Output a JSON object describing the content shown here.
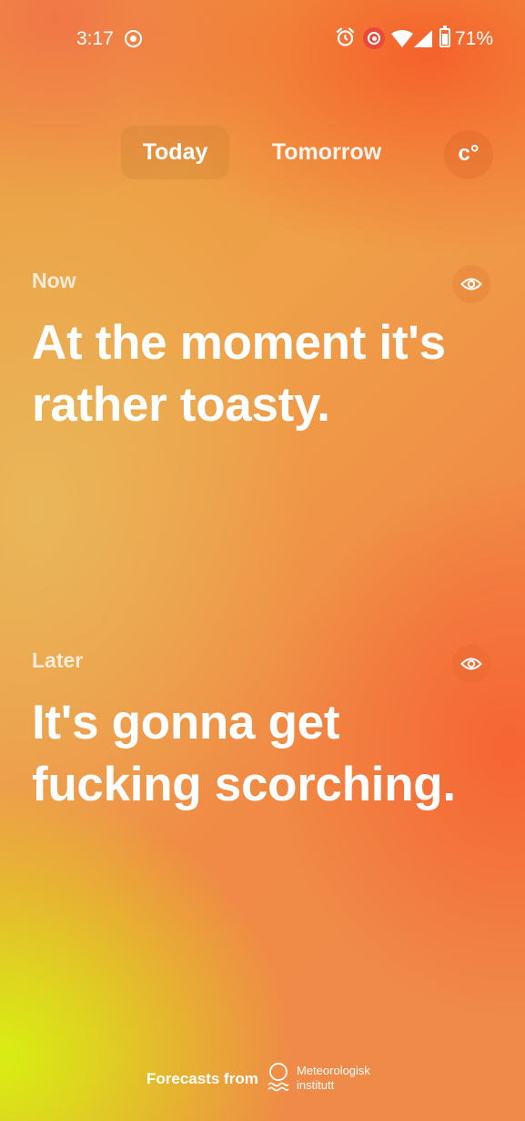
{
  "status_bar": {
    "time": "3:17",
    "battery": "71%",
    "icons": [
      "screen-record-icon",
      "alarm-icon",
      "recording-icon",
      "wifi-icon",
      "cell-signal-icon",
      "battery-icon"
    ]
  },
  "tabs": [
    {
      "label": "Today",
      "selected": true
    },
    {
      "label": "Tomorrow",
      "selected": false
    }
  ],
  "unit_toggle": "c°",
  "now": {
    "label": "Now",
    "headline": "At the moment it's rather toasty."
  },
  "later": {
    "label": "Later",
    "headline": "It's gonna get fucking scorching."
  },
  "footer": {
    "text": "Forecasts from",
    "provider_line1": "Meteorologisk",
    "provider_line2": "institutt"
  },
  "colors": {
    "orange": "#f26a35",
    "amber": "#eca043",
    "lime": "#d8ee12",
    "text": "#ffffff"
  }
}
